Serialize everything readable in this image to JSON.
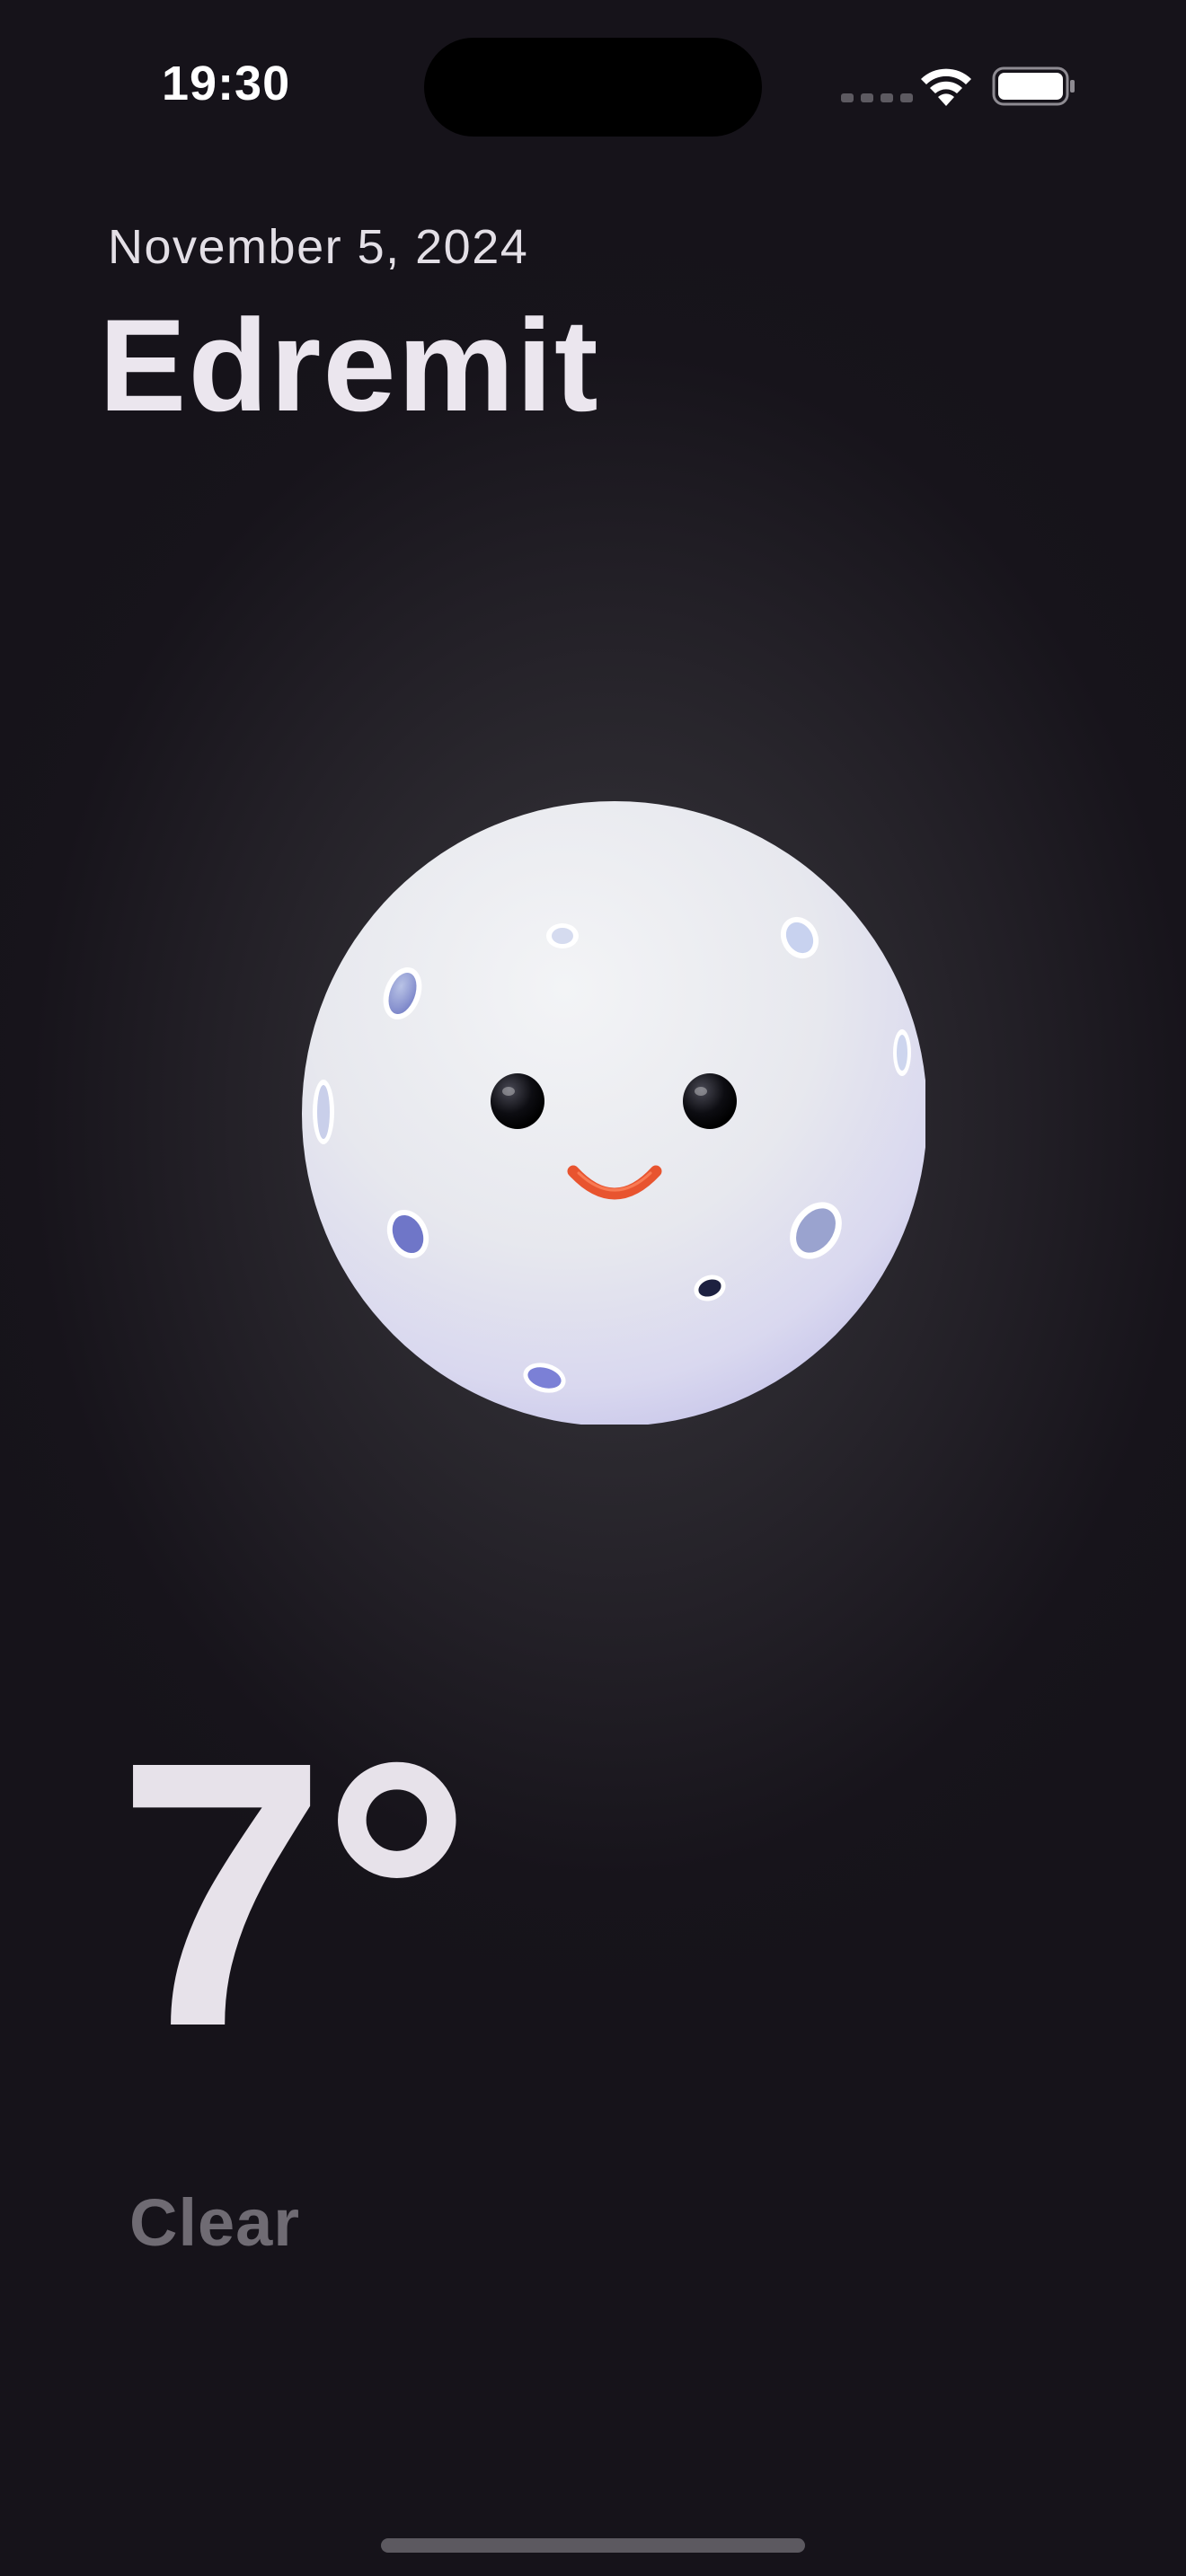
{
  "status_bar": {
    "time": "19:30",
    "icons": [
      "signal-icon",
      "wifi-icon",
      "battery-icon"
    ]
  },
  "header": {
    "date": "November 5, 2024",
    "city": "Edremit"
  },
  "illustration": {
    "icon": "moon-face-icon"
  },
  "weather": {
    "temperature": "7°",
    "condition": "Clear"
  },
  "colors": {
    "background": "#16131a",
    "primary_text": "#e7e2ea",
    "secondary_text": "#6f6b73",
    "moon": "#eeeff3",
    "smile": "#e8542f"
  }
}
